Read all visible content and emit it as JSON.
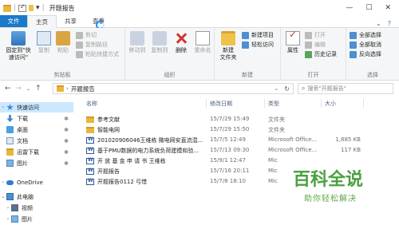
{
  "window": {
    "title": "开题报告",
    "minimize_glyph": "—",
    "maximize_glyph": "☐",
    "close_glyph": "✕"
  },
  "tabs": [
    {
      "label": "文件"
    },
    {
      "label": "主页"
    },
    {
      "label": "共享"
    },
    {
      "label": "查看"
    }
  ],
  "ribbon": {
    "clipboard": {
      "pin_label": "固定到\"快速访问\"",
      "copy_label": "复制",
      "paste_label": "粘贴",
      "copy_path_label": "复制路径",
      "paste_shortcut_label": "粘贴快捷方式",
      "cut_label": "剪切",
      "group_label": "剪贴板"
    },
    "organize": {
      "move_to_label": "移动到",
      "copy_to_label": "复制到",
      "delete_label": "删除",
      "rename_label": "重命名",
      "group_label": "组织"
    },
    "new": {
      "new_folder_label": "新建\n文件夹",
      "new_item_label": "新建项目",
      "easy_access_label": "轻松访问",
      "group_label": "新建"
    },
    "open": {
      "properties_label": "属性",
      "open_label": "打开",
      "edit_label": "编辑",
      "history_label": "历史记录",
      "group_label": "打开"
    },
    "select": {
      "select_all_label": "全部选择",
      "select_none_label": "全部取消",
      "invert_label": "反向选择",
      "group_label": "选择"
    }
  },
  "address": {
    "crumb": "开题报告",
    "search_placeholder": "搜索\"开题报告\""
  },
  "nav_pane": {
    "items": [
      {
        "label": "快速访问",
        "icon": "star-icon",
        "pinned": false,
        "selected": true
      },
      {
        "label": "下载",
        "icon": "download-icon",
        "pinned": true
      },
      {
        "label": "桌面",
        "icon": "desktop-icon",
        "pinned": true
      },
      {
        "label": "文档",
        "icon": "document-icon",
        "pinned": true
      },
      {
        "label": "迅雷下载",
        "icon": "folder-icon",
        "pinned": true
      },
      {
        "label": "图片",
        "icon": "picture-icon",
        "pinned": true
      },
      {
        "label": "OneDrive",
        "icon": "cloud-icon",
        "pinned": false
      },
      {
        "label": "此电脑",
        "icon": "pc-icon",
        "pinned": false
      },
      {
        "label": "视频",
        "icon": "video-icon",
        "pinned": false
      },
      {
        "label": "图片",
        "icon": "picture-icon",
        "pinned": false
      }
    ]
  },
  "file_list": {
    "columns": {
      "name": "名称",
      "modified": "修改日期",
      "type": "类型",
      "size": "大小"
    },
    "rows": [
      {
        "name": "参考文献",
        "modified": "15/7/29 15:49",
        "type": "文件夹",
        "size": "",
        "icon": "folder-icon"
      },
      {
        "name": "智能电网",
        "modified": "15/7/29 15:50",
        "type": "文件夹",
        "size": "",
        "icon": "folder-icon"
      },
      {
        "name": "201020906046王维栋 微电网安直流混...",
        "modified": "15/7/5 12:49",
        "type": "Microsoft Office...",
        "size": "1,885 KB",
        "icon": "word-icon"
      },
      {
        "name": "基于PMU数据的电力系统负荷建模和验...",
        "modified": "15/7/13 09:30",
        "type": "Microsoft Office...",
        "size": "117 KB",
        "icon": "word-icon"
      },
      {
        "name": "开 放 基 金 申 请 书  王维栋",
        "modified": "15/9/1 12:47",
        "type": "Mic",
        "size": "",
        "icon": "word-icon"
      },
      {
        "name": "开题报告",
        "modified": "15/7/16 20:11",
        "type": "Mic",
        "size": "",
        "icon": "word-icon"
      },
      {
        "name": "开题报告0112 弓惜",
        "modified": "15/7/8 18:10",
        "type": "Mic",
        "size": "",
        "icon": "word-icon"
      }
    ]
  },
  "watermark": {
    "title": "百科全说",
    "subtitle": "助你轻松解决"
  },
  "colors": {
    "accent": "#1979ca",
    "selection": "#cce8ff",
    "folder": "#e8b73c",
    "watermark": "#4aa03f"
  }
}
